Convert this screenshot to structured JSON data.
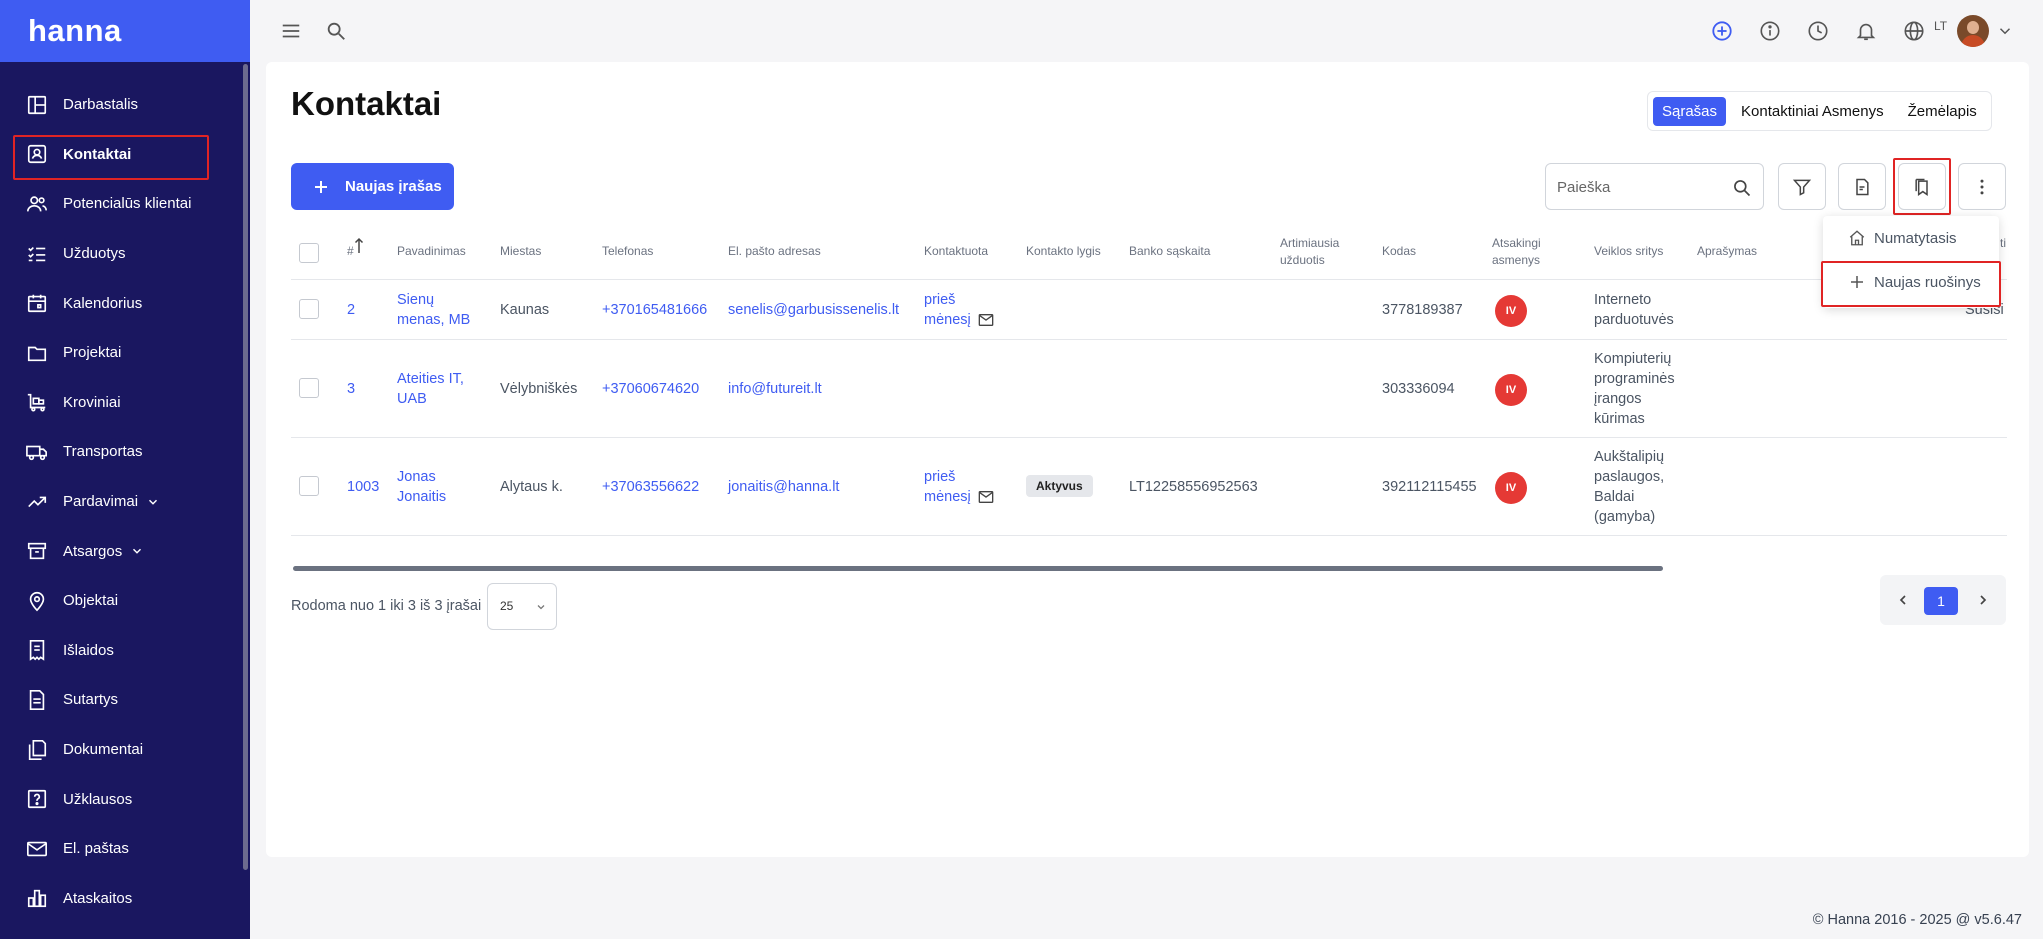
{
  "app": {
    "name": "hanna"
  },
  "sidebar": {
    "items": [
      {
        "label": "Darbastalis",
        "icon": "dashboard-icon"
      },
      {
        "label": "Kontaktai",
        "icon": "contacts-icon",
        "active": true
      },
      {
        "label": "Potencialūs klientai",
        "icon": "leads-icon"
      },
      {
        "label": "Užduotys",
        "icon": "tasks-icon"
      },
      {
        "label": "Kalendorius",
        "icon": "calendar-icon"
      },
      {
        "label": "Projektai",
        "icon": "folder-icon"
      },
      {
        "label": "Kroviniai",
        "icon": "cargo-icon"
      },
      {
        "label": "Transportas",
        "icon": "truck-icon"
      },
      {
        "label": "Pardavimai",
        "icon": "trend-icon",
        "expandable": true
      },
      {
        "label": "Atsargos",
        "icon": "archive-icon",
        "expandable": true
      },
      {
        "label": "Objektai",
        "icon": "location-pin-icon"
      },
      {
        "label": "Išlaidos",
        "icon": "receipt-icon"
      },
      {
        "label": "Sutartys",
        "icon": "document-icon"
      },
      {
        "label": "Dokumentai",
        "icon": "documents-icon"
      },
      {
        "label": "Užklausos",
        "icon": "question-icon"
      },
      {
        "label": "El. paštas",
        "icon": "mail-icon"
      },
      {
        "label": "Ataskaitos",
        "icon": "bar-chart-icon"
      }
    ]
  },
  "topbar": {
    "language": "LT"
  },
  "page": {
    "title": "Kontaktai",
    "view_tabs": [
      "Sąrašas",
      "Kontaktiniai Asmenys",
      "Žemėlapis"
    ],
    "new_button": "Naujas įrašas",
    "search_placeholder": "Paieška"
  },
  "table": {
    "headers": {
      "num": "#",
      "name": "Pavadinimas",
      "city": "Miestas",
      "phone": "Telefonas",
      "email": "El. pašto adresas",
      "contacted": "Kontaktuota",
      "level": "Kontakto lygis",
      "bank": "Banko sąskaita",
      "task": "Artimiausia užduotis",
      "code": "Kodas",
      "responsible": "Atsakingi asmenys",
      "activity": "Veiklos sritys",
      "description": "Aprašymas",
      "cut": "ti"
    },
    "rows": [
      {
        "num": "2",
        "name": "Sienų menas, MB",
        "city": "Kaunas",
        "phone": "+370165481666",
        "email": "senelis@garbusissenelis.lt",
        "contacted": "prieš mėnesį",
        "level": "",
        "bank": "",
        "code": "3778189387",
        "responsible": "IV",
        "activity": "Interneto parduotuvės",
        "extra": "Susisi"
      },
      {
        "num": "3",
        "name": "Ateities IT, UAB",
        "city": "Vėlybniškės",
        "phone": "+37060674620",
        "email": "info@futureit.lt",
        "contacted": "",
        "level": "",
        "bank": "",
        "code": "303336094",
        "responsible": "IV",
        "activity": "Kompiuterių programinės įrangos kūrimas",
        "extra": ""
      },
      {
        "num": "1003",
        "name": "Jonas Jonaitis",
        "city": "Alytaus k.",
        "phone": "+37063556622",
        "email": "jonaitis@hanna.lt",
        "contacted": "prieš mėnesį",
        "level": "Aktyvus",
        "bank": "LT12258556952563",
        "code": "392112115455",
        "responsible": "IV",
        "activity": "Aukštalipių paslaugos, Baldai (gamyba)",
        "extra": ""
      }
    ]
  },
  "footer": {
    "showing": "Rodoma nuo 1 iki 3 iš 3 įrašai",
    "page_size": "25",
    "current_page": "1",
    "copyright": "© Hanna 2016 - 2025 @ v5.6.47"
  },
  "dropdown": {
    "items": [
      "Numatytasis",
      "Naujas ruošinys"
    ]
  },
  "colors": {
    "primary": "#3f5cf2",
    "sidebar": "#1a1760",
    "danger": "#e53935",
    "highlight": "#e02424"
  }
}
